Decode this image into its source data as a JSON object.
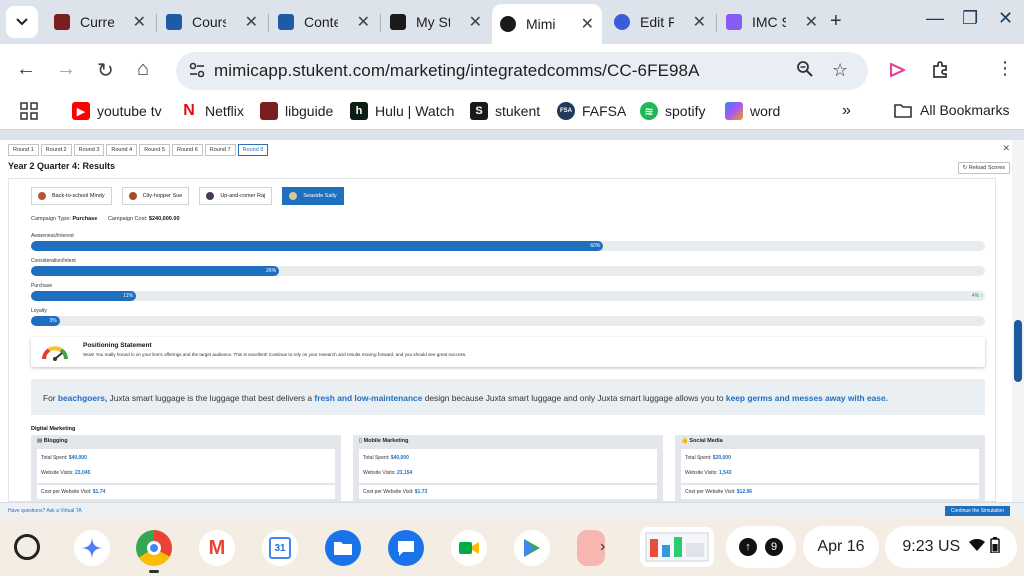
{
  "browser": {
    "tabs": [
      {
        "title": "Curre",
        "icon": "puzzle-mascot-icon",
        "active": false
      },
      {
        "title": "Cours",
        "icon": "stukent-a-icon",
        "active": false
      },
      {
        "title": "Conte",
        "icon": "stukent-a-icon",
        "active": false
      },
      {
        "title": "My St",
        "icon": "stukent-s-icon",
        "active": false
      },
      {
        "title": "Mimi",
        "icon": "stukent-s-icon",
        "active": true
      },
      {
        "title": "Edit F",
        "icon": "quizlet-icon",
        "active": false
      },
      {
        "title": "IMC S",
        "icon": "copilot-icon",
        "active": false
      }
    ],
    "url": "mimicapp.stukent.com/marketing/integratedcomms/CC-6FE98A",
    "bookmarks": [
      {
        "label": "youtube tv",
        "icon": "youtube-icon",
        "color": "#ff0000"
      },
      {
        "label": "Netflix",
        "icon": "netflix-icon",
        "color": "#e50914"
      },
      {
        "label": "libguide",
        "icon": "puzzle-mascot-icon",
        "color": "#7a1f1f"
      },
      {
        "label": "Hulu | Watch",
        "icon": "hulu-icon",
        "color": "#0b1e14"
      },
      {
        "label": "stukent",
        "icon": "stukent-s-icon",
        "color": "#1a1a1a"
      },
      {
        "label": "FAFSA",
        "icon": "fafsa-icon",
        "color": "#1f3a5c"
      },
      {
        "label": "spotify",
        "icon": "spotify-icon",
        "color": "#1db954"
      },
      {
        "label": "word",
        "icon": "copilot-icon",
        "color": "#8a5cf6"
      }
    ],
    "all_bookmarks": "All Bookmarks"
  },
  "page": {
    "rounds": [
      "Round 1",
      "Round 2",
      "Round 3",
      "Round 4",
      "Round 5",
      "Round 6",
      "Round 7",
      "Round 8"
    ],
    "active_round": "Round 8",
    "title": "Year 2 Quarter 4: Results",
    "reload": "Reload Scores",
    "personas": [
      {
        "name": "Back-to-school Mindy",
        "color": "#b5553a"
      },
      {
        "name": "City-hopper Sue",
        "color": "#a34b2a"
      },
      {
        "name": "Up-and-comer Raj",
        "color": "#4a3a5a"
      },
      {
        "name": "Seaside Sally",
        "color": "#d9c59b"
      }
    ],
    "campaign_type_label": "Campaign Type:",
    "campaign_type": "Purchase",
    "campaign_cost_label": "Campaign Cost:",
    "campaign_cost": "$240,000.00",
    "funnel": [
      {
        "label": "Awareness/Interest",
        "value_text": "60%",
        "value": 0.6,
        "delta": ""
      },
      {
        "label": "Consideration/Intent",
        "value_text": "26%",
        "value": 0.26,
        "delta": ""
      },
      {
        "label": "Purchase",
        "value_text": "11%",
        "value": 0.11,
        "delta": "4% ↑"
      },
      {
        "label": "Loyalty",
        "value_text": "3%",
        "value": 0.03,
        "delta": ""
      }
    ],
    "positioning": {
      "title": "Positioning Statement",
      "text": "Wow! You really honed in on your line's offerings and the target audience. This is excellent! Continue to rely on your research and results moving forward, and you should see great success."
    },
    "statement": {
      "p1": "For ",
      "audience": "beachgoers,",
      "p2": " Juxta smart luggage is the luggage that best delivers a ",
      "benefit": "fresh and low-maintenance",
      "p3": " design because Juxta smart luggage and only Juxta smart luggage allows you to ",
      "reason": "keep germs and messes away with ease."
    },
    "digital_marketing": {
      "title": "Digital Marketing",
      "cards": [
        {
          "name": "Blogging",
          "icon": "blog-icon",
          "total_label": "Total Spent:",
          "total": "$40,000",
          "visits_label": "Website Visits:",
          "visits": "23,045",
          "cpv_label": "Cost per Website Visit:",
          "cpv": "$1.74"
        },
        {
          "name": "Mobile Marketing",
          "icon": "phone-icon",
          "total_label": "Total Spent:",
          "total": "$40,000",
          "visits_label": "Website Visits:",
          "visits": "23,154",
          "cpv_label": "Cost per Website Visit:",
          "cpv": "$1.73"
        },
        {
          "name": "Social Media",
          "icon": "thumbs-up-icon",
          "total_label": "Total Spent:",
          "total": "$20,000",
          "visits_label": "Website Visits:",
          "visits": "1,543",
          "cpv_label": "Cost per Website Visit:",
          "cpv": "$12.96"
        }
      ]
    },
    "footer_help": "Have questions? Ask a Virtual TA",
    "continue": "Continue the Simulation"
  },
  "shelf": {
    "apps": [
      "gemini-icon",
      "chrome-icon",
      "gmail-icon",
      "calendar-icon",
      "files-icon",
      "messages-icon",
      "meet-icon",
      "play-store-icon"
    ],
    "calendar_day": "31",
    "notif_count": "9",
    "date": "Apr 16",
    "time": "9:23",
    "locale": "US"
  }
}
